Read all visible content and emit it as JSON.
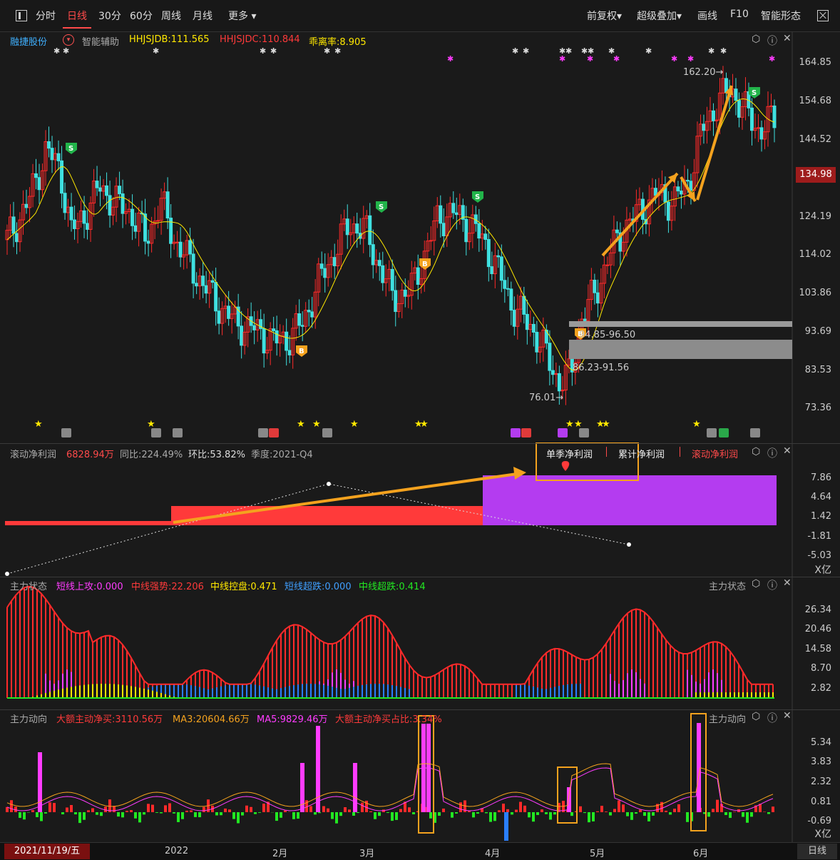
{
  "toolbar": {
    "left_items": [
      "分时",
      "日线",
      "30分",
      "60分",
      "周线",
      "月线",
      "更多"
    ],
    "right_items": [
      "前复权",
      "超级叠加",
      "画线",
      "F10",
      "智能形态"
    ]
  },
  "main_panel": {
    "stock_name": "融捷股份",
    "assist": "智能辅助",
    "ind1": "HHJSJDB:111.565",
    "ind2": "HHJSJDC:110.844",
    "ind3": "乖离率:8.905",
    "y_ticks": [
      "164.85",
      "154.68",
      "144.52",
      "134.98",
      "124.19",
      "114.02",
      "103.86",
      "93.69",
      "83.53",
      "73.36"
    ],
    "current_price": "134.98",
    "high_label": "162.20→",
    "low_label": "76.01→",
    "zone1": "94.85-96.50",
    "zone2": "86.23-91.56"
  },
  "profit_panel": {
    "title": "滚动净利润",
    "value": "6828.94万",
    "yoy": "同比:224.49%",
    "qoq": "环比:53.82%",
    "season": "季度:2021-Q4",
    "tabs": [
      "单季净利润",
      "累计净利润",
      "滚动净利润"
    ],
    "y_ticks": [
      "7.86",
      "4.64",
      "1.42",
      "-1.81",
      "-5.03"
    ],
    "unit": "X亿"
  },
  "state_panel": {
    "title": "主力状态",
    "f1": "短线上攻:0.000",
    "f2": "中线强势:22.206",
    "f3": "中线控盘:0.471",
    "f4": "短线超跌:0.000",
    "f5": "中线超跌:0.414",
    "right_title": "主力状态",
    "y_ticks": [
      "26.34",
      "20.46",
      "14.58",
      "8.70",
      "2.82"
    ]
  },
  "flow_panel": {
    "title": "主力动向",
    "f1": "大额主动净买:3110.56万",
    "f2": "MA3:20604.66万",
    "f3": "MA5:9829.46万",
    "f4": "大额主动净买占比:3.34%",
    "right_title": "主力动向",
    "y_ticks": [
      "5.34",
      "3.83",
      "2.32",
      "0.81",
      "-0.69"
    ],
    "unit": "X亿"
  },
  "bottom_axis": {
    "date": "2021/11/19/五",
    "labels": [
      "2022",
      "2月",
      "3月",
      "4月",
      "5月",
      "6月"
    ],
    "period": "日线"
  },
  "colors": {
    "up": "#ff2a2a",
    "down": "#3fe0e0",
    "yellow": "#ffe800",
    "magenta": "#ff3cff",
    "orange": "#f4a21e",
    "purple": "#b43cf0",
    "blue": "#2a7fff",
    "green": "#22e822"
  }
}
